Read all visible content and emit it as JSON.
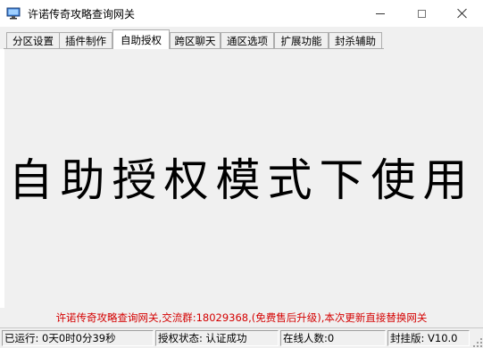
{
  "window": {
    "title": "许诺传奇攻略查询网关",
    "icon": "monitor-icon",
    "controls": [
      "minimize-icon",
      "maximize-icon",
      "close-icon"
    ]
  },
  "tabs": [
    {
      "label": "分区设置",
      "active": false
    },
    {
      "label": "插件制作",
      "active": false
    },
    {
      "label": "自助授权",
      "active": true
    },
    {
      "label": "跨区聊天",
      "active": false
    },
    {
      "label": "通区选项",
      "active": false
    },
    {
      "label": "扩展功能",
      "active": false
    },
    {
      "label": "封杀辅助",
      "active": false
    }
  ],
  "main": {
    "banner": "自助授权模式下使用"
  },
  "notice": {
    "text": "许诺传奇攻略查询网关,交流群:18029368,(免费售后升级),本次更新直接替换网关",
    "color": "#d40000"
  },
  "status": {
    "uptime": "已运行: 0天0时0分39秒",
    "auth": "授权状态: 认证成功",
    "online": "在线人数:0",
    "version": "封挂版: V10.0"
  },
  "colors": {
    "window_bg": "#f0f0f0",
    "titlebar_bg": "#ffffff",
    "active_tab_bg": "#ffffff"
  }
}
